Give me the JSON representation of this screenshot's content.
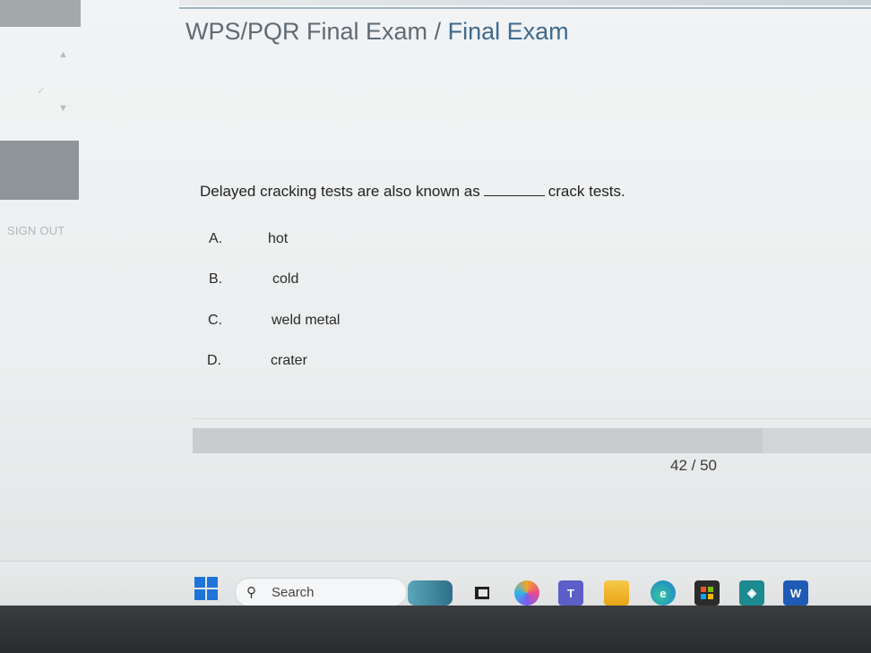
{
  "header": {
    "breadcrumb_parent": "WPS/PQR Final Exam",
    "separator": "/",
    "breadcrumb_current": "Final Exam"
  },
  "sidebar": {
    "sign_out_label": "SIGN OUT"
  },
  "question": {
    "text_before": "Delayed cracking tests are also known as",
    "text_after": "crack tests.",
    "options": [
      {
        "letter": "A.",
        "text": "hot"
      },
      {
        "letter": "B.",
        "text": "cold"
      },
      {
        "letter": "C.",
        "text": "weld metal"
      },
      {
        "letter": "D.",
        "text": "crater"
      }
    ]
  },
  "progress": {
    "current": 42,
    "total": 50,
    "label": "42 / 50",
    "fraction": 0.84
  },
  "taskbar": {
    "search_placeholder": "Search",
    "icons": [
      "windows-start-icon",
      "widgets-icon",
      "task-view-icon",
      "copilot-icon",
      "teams-icon",
      "file-explorer-icon",
      "edge-icon",
      "store-icon",
      "app-icon",
      "word-icon"
    ]
  },
  "colors": {
    "accent": "#3e6a8e",
    "title_gray": "#5f6a73",
    "start_blue": "#1e74d8"
  }
}
